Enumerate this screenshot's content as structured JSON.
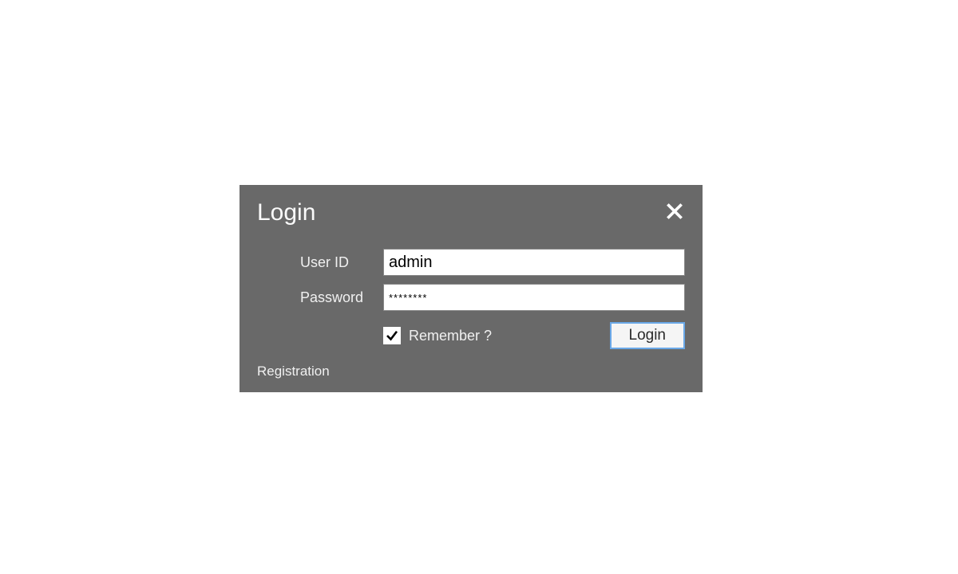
{
  "dialog": {
    "title": "Login",
    "user_id_label": "User ID",
    "user_id_value": "admin",
    "password_label": "Password",
    "password_value": "********",
    "remember_label": "Remember ?",
    "remember_checked": true,
    "login_button_label": "Login",
    "registration_link_label": "Registration"
  }
}
